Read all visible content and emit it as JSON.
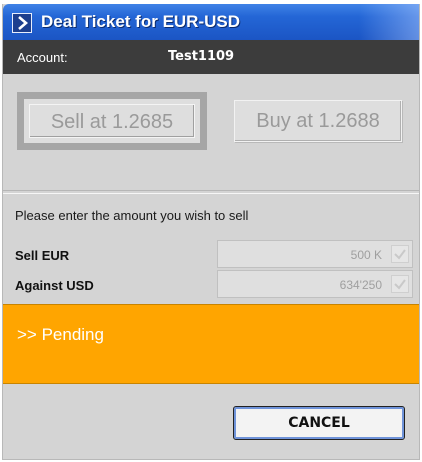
{
  "window": {
    "title": "Deal Ticket for EUR-USD"
  },
  "account": {
    "label": "Account:",
    "value": "Test1109"
  },
  "rates": {
    "sell_label": "Sell at 1.2685",
    "buy_label": "Buy at 1.2688"
  },
  "form": {
    "prompt": "Please enter the amount you wish to sell",
    "sell_label": "Sell EUR",
    "sell_value": "500 K",
    "against_label": "Against USD",
    "against_value": "634'250"
  },
  "status": {
    "text": ">> Pending",
    "color": "#ffa500"
  },
  "footer": {
    "cancel_label": "CANCEL"
  }
}
